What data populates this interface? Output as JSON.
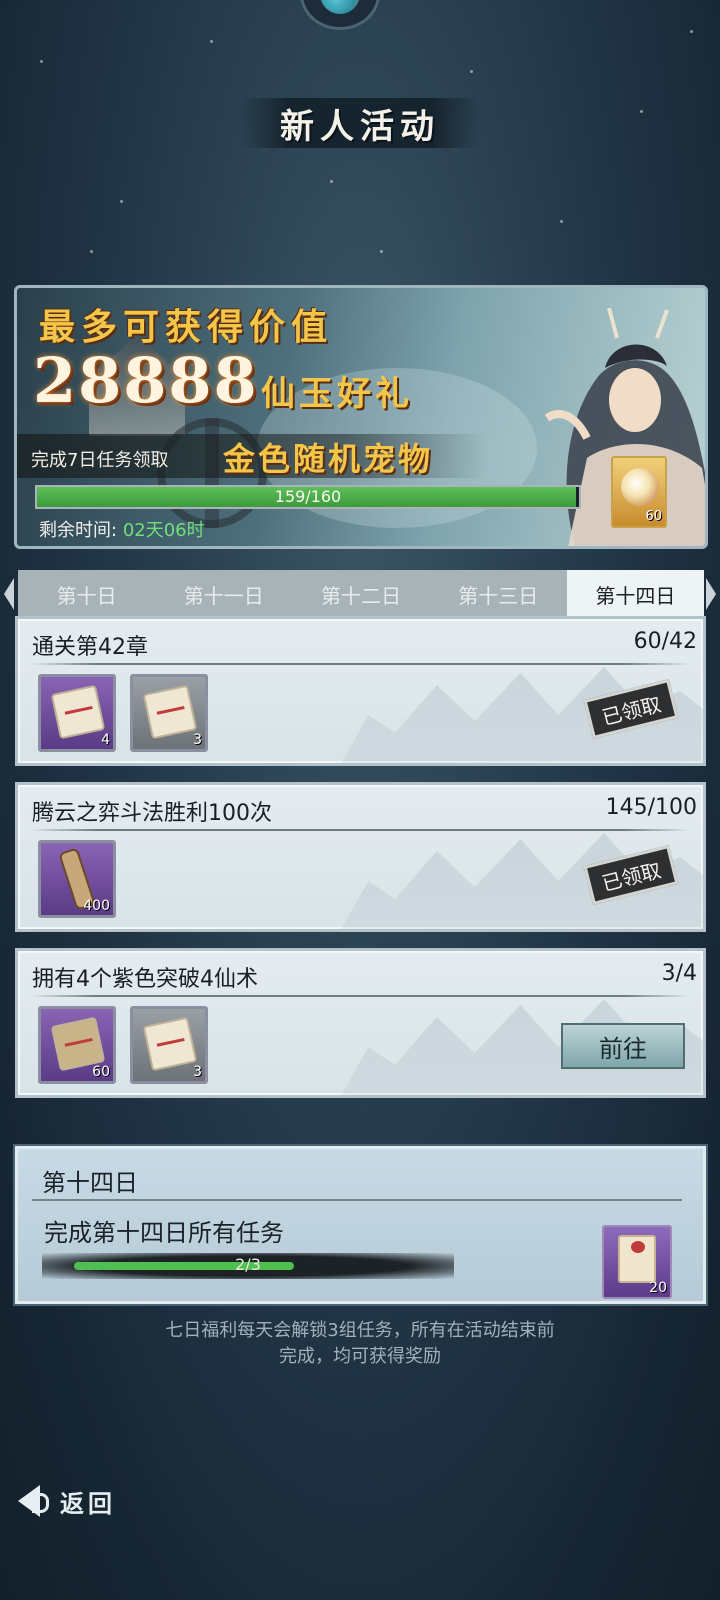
{
  "page": {
    "title": "新人活动"
  },
  "banner": {
    "headline": "最多可获得价值",
    "amount": "28888",
    "gift": "仙玉好礼",
    "subtitle_left": "完成7日任务领取",
    "subtitle_right": "金色随机宠物",
    "progress_text": "159/160",
    "progress_fraction": 0.99375,
    "remaining_label": "剩余时间:",
    "remaining_value": "02天06时",
    "reward_count": "60"
  },
  "tabs": [
    {
      "label": "第十日",
      "active": false
    },
    {
      "label": "第十一日",
      "active": false
    },
    {
      "label": "第十二日",
      "active": false
    },
    {
      "label": "第十三日",
      "active": false
    },
    {
      "label": "第十四日",
      "active": true
    }
  ],
  "tasks": [
    {
      "title": "通关第42章",
      "progress": "60/42",
      "items": [
        {
          "icon": "scroll-scripture-icon",
          "count": "4"
        },
        {
          "icon": "paper-map-icon",
          "count": "3"
        }
      ],
      "status": "已领取"
    },
    {
      "title": "腾云之弈斗法胜利100次",
      "progress": "145/100",
      "items": [
        {
          "icon": "rolled-scroll-icon",
          "count": "400"
        }
      ],
      "status": "已领取"
    },
    {
      "title": "拥有4个紫色突破4仙术",
      "progress": "3/4",
      "items": [
        {
          "icon": "fragment-icon",
          "count": "60"
        },
        {
          "icon": "paper-map-icon",
          "count": "3"
        }
      ],
      "action": "前往"
    }
  ],
  "summary": {
    "day": "第十四日",
    "description": "完成第十四日所有任务",
    "progress_text": "2/3",
    "progress_fraction": 0.6667,
    "reward_count": "20"
  },
  "footnote": {
    "line1": "七日福利每天会解锁3组任务，所有在活动结束前",
    "line2": "完成，均可获得奖励"
  },
  "back": {
    "label": "返回"
  }
}
